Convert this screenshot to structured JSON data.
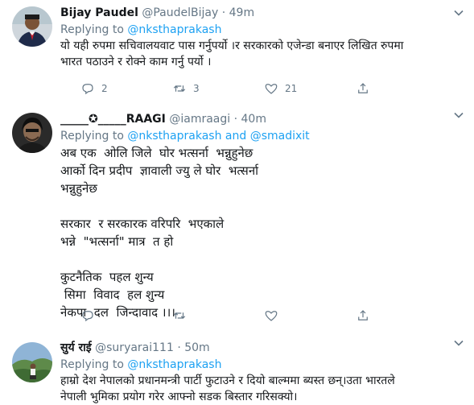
{
  "tweets": [
    {
      "name": "Bijay Paudel",
      "handle": "@PaudelBijay",
      "dot": "·",
      "time": "49m",
      "replying_prefix": "Replying to ",
      "replying_to": "@nksthaprakash",
      "text": "यो यही रुपमा सचिवालयवाट पास गर्नुपर्यो ।र सरकारको एजेन्डा बनाएर लिखित रुपमा\nभारत पठाउने र रोक्ने काम गर्नु पर्यो ।",
      "counts": {
        "reply": "2",
        "retweet": "3",
        "like": "21"
      }
    },
    {
      "name": "_____✪_____RAAGI",
      "handle": "@iamraagi",
      "dot": "·",
      "time": "40m",
      "replying_prefix": "Replying to ",
      "replying_to": "@nksthaprakash",
      "replying_and": " and ",
      "replying_to_2": "@smadixit",
      "text": "अब एक  ओलि जिले  घोर भत्सर्ना  भन्नुहुनेछ\nआर्को दिन प्रदीप  ज्ञावाली ज्यु ले घोर  भत्सर्ना\nभन्नुहुनेछ\n\nसरकार  र सरकारक वरिपरि  भएकाले\nभन्ने  \"भत्सर्ना\" मात्र  त हो\n\nकुटनैतिक  पहल शुन्य\n सिमा  विवाद  हल शुन्य\nनेकपा  दल  जिन्दावाद ।।।",
      "counts": {
        "reply": "",
        "retweet": "",
        "like": ""
      }
    },
    {
      "name": "सुर्य राई",
      "handle": "@suryarai111",
      "dot": "·",
      "time": "50m",
      "replying_prefix": "Replying to ",
      "replying_to": "@nksthaprakash",
      "text": "हाम्रो देश नेपालको प्रधानमन्त्री पार्टी फुटाउने र दियो बाल्ममा ब्यस्त छन्।उता भारतले\nनेपाली भुमिका प्रयोग गरेर आफ्नो सडक बिस्तार गरिसक्यो।"
    }
  ],
  "colors": {
    "accent": "#1da1f2",
    "muted": "#657786",
    "like": "#e0245e",
    "retweet": "#17bf63"
  },
  "icons": [
    "chevron-down-icon",
    "reply-icon",
    "retweet-icon",
    "like-icon",
    "share-icon"
  ]
}
